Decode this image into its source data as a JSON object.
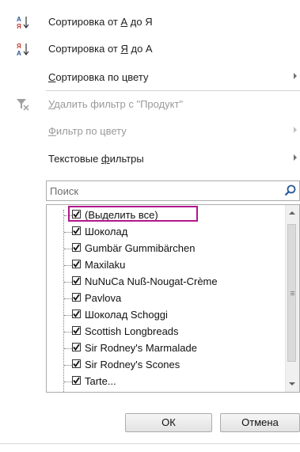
{
  "menu": {
    "sort_asc": {
      "prefix": "Сортировка от ",
      "from": "А",
      "mid": " до ",
      "to": "Я"
    },
    "sort_desc": {
      "prefix": "Сортировка от ",
      "from": "Я",
      "mid": " до ",
      "to": "А"
    },
    "sort_color": {
      "first": "С",
      "rest": "ортировка по цвету"
    },
    "clear_filter": {
      "first": "У",
      "rest": "далить фильтр с \"Продукт\""
    },
    "filter_color": {
      "first": "Ф",
      "rest": "ильтр по цвету"
    },
    "text_filters": {
      "before": "Текстовые ",
      "u": "ф",
      "after": "ильтры"
    }
  },
  "search": {
    "placeholder": "Поиск"
  },
  "list": {
    "items": [
      "(Выделить все)",
      "Шоколад",
      "Gumbär Gummibärchen",
      "Maxilaku",
      "NuNuCa Nuß-Nougat-Crème",
      "Pavlova",
      "Шоколад Schoggi",
      "Scottish Longbreads",
      "Sir Rodney's Marmalade",
      "Sir Rodney's Scones",
      "Tarte..."
    ]
  },
  "buttons": {
    "ok": "ОК",
    "cancel": "Отмена"
  },
  "colors": {
    "highlight": "#b1178c",
    "sort_blue": "#2b5797",
    "sort_red": "#c0392b"
  },
  "icons": {
    "sort_asc": "sort-a-to-z-icon",
    "sort_desc": "sort-z-to-a-icon",
    "clear_filter": "clear-filter-icon",
    "search": "magnifier-icon"
  }
}
